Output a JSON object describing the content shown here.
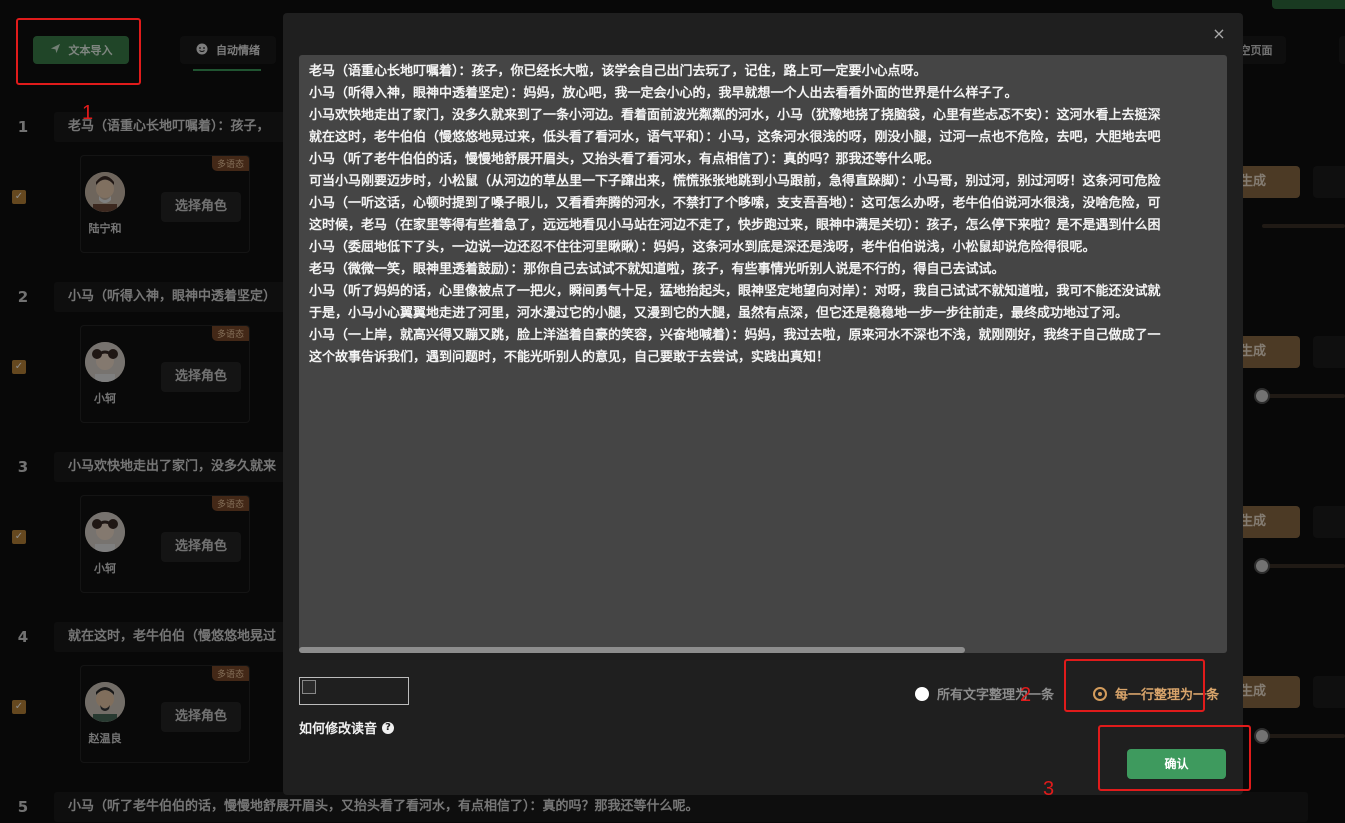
{
  "toolbar": {
    "import_label": "文本导入",
    "emotion_tab_label": "自动情绪",
    "clear_label": "空页面"
  },
  "annotations": [
    "1",
    "2",
    "3"
  ],
  "rows": [
    {
      "num": "1",
      "text": "老马（语重心长地叮嘱着）：孩子，",
      "badge": "多语态",
      "role_name": "陆宁和",
      "choose_label": "选择角色",
      "generate_label": "生成"
    },
    {
      "num": "2",
      "text": "小马（听得入神，眼神中透着坚定）",
      "badge": "多语态",
      "role_name": "小轲",
      "choose_label": "选择角色",
      "generate_label": "生成"
    },
    {
      "num": "3",
      "text": "小马欢快地走出了家门，没多久就来",
      "badge": "多语态",
      "role_name": "小轲",
      "choose_label": "选择角色",
      "generate_label": "生成"
    },
    {
      "num": "4",
      "text": "就在这时，老牛伯伯（慢悠悠地晃过",
      "badge": "多语态",
      "role_name": "赵温良",
      "choose_label": "选择角色",
      "generate_label": "生成"
    },
    {
      "num": "5",
      "text": "小马（听了老牛伯伯的话，慢慢地舒展开眉头，又抬头看了看河水，有点相信了）：真的吗？那我还等什么呢。"
    }
  ],
  "dialog": {
    "close_symbol": "×",
    "lines": [
      "老马（语重心长地叮嘱着）：孩子，你已经长大啦，该学会自己出门去玩了，记住，路上可一定要小心点呀。",
      "小马（听得入神，眼神中透着坚定）：妈妈，放心吧，我一定会小心的，我早就想一个人出去看看外面的世界是什么样子了。",
      "小马欢快地走出了家门，没多久就来到了一条小河边。看着面前波光粼粼的河水，小马（犹豫地挠了挠脑袋，心里有些忐忑不安）：这河水看上去挺深",
      "就在这时，老牛伯伯（慢悠悠地晃过来，低头看了看河水，语气平和）：小马，这条河水很浅的呀，刚没小腿，过河一点也不危险，去吧，大胆地去吧",
      "小马（听了老牛伯伯的话，慢慢地舒展开眉头，又抬头看了看河水，有点相信了）：真的吗？那我还等什么呢。",
      "可当小马刚要迈步时，小松鼠（从河边的草丛里一下子蹿出来，慌慌张张地跳到小马跟前，急得直跺脚）：小马哥，别过河，别过河呀！这条河可危险",
      "小马（一听这话，心顿时提到了嗓子眼儿，又看看奔腾的河水，不禁打了个哆嗦，支支吾吾地）：这可怎么办呀，老牛伯伯说河水很浅，没啥危险，可",
      "这时候，老马（在家里等得有些着急了，远远地看见小马站在河边不走了，快步跑过来，眼神中满是关切）：孩子，怎么停下来啦？是不是遇到什么困",
      "小马（委屈地低下了头，一边说一边还忍不住往河里瞅瞅）：妈妈，这条河水到底是深还是浅呀，老牛伯伯说浅，小松鼠却说危险得很呢。",
      "老马（微微一笑，眼神里透着鼓励）：那你自己去试试不就知道啦，孩子，有些事情光听别人说是不行的，得自己去试试。",
      "小马（听了妈妈的话，心里像被点了一把火，瞬间勇气十足，猛地抬起头，眼神坚定地望向对岸）：对呀，我自己试试不就知道啦，我可不能还没试就",
      "于是，小马小心翼翼地走进了河里，河水漫过它的小腿，又漫到它的大腿，虽然有点深，但它还是稳稳地一步一步往前走，最终成功地过了河。",
      "小马（一上岸，就高兴得又蹦又跳，脸上洋溢着自豪的笑容，兴奋地喊着）：妈妈，我过去啦，原来河水不深也不浅，就刚刚好，我终于自己做成了一",
      "这个故事告诉我们，遇到问题时，不能光听别人的意见，自己要敢于去尝试，实践出真知！"
    ],
    "how_label": "如何修改读音",
    "help_symbol": "?",
    "option_all": "所有文字整理为一条",
    "option_each": "每一行整理为一条",
    "confirm_label": "确认"
  },
  "colors": {
    "accent_green": "#3e9a5e",
    "accent_gold": "#d39c5c",
    "annotation_red": "#e01b1b"
  }
}
